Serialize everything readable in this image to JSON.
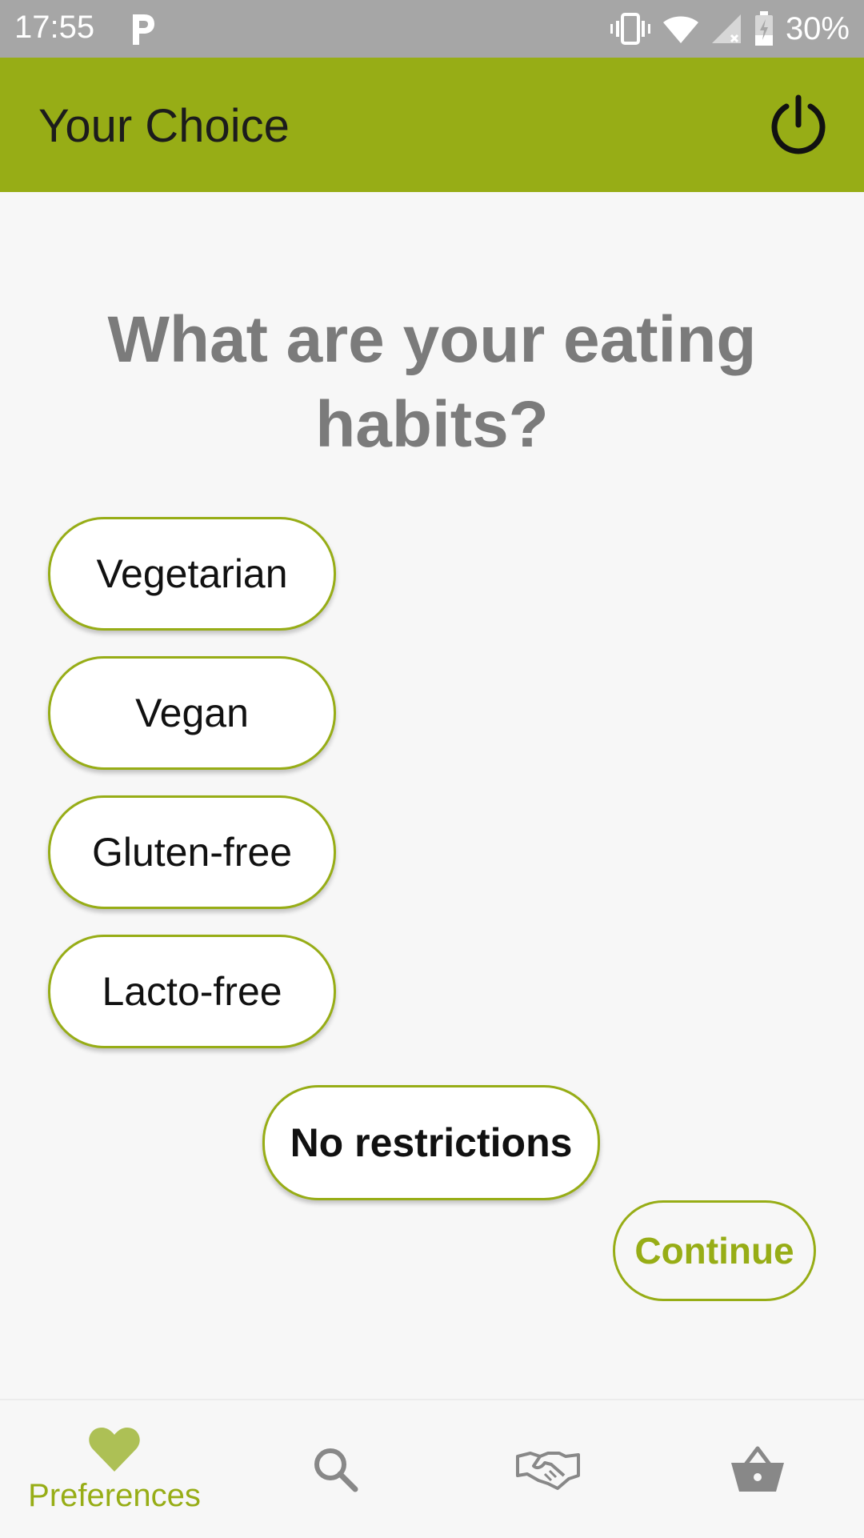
{
  "status_bar": {
    "time": "17:55",
    "battery": "30%"
  },
  "app_bar": {
    "title": "Your Choice",
    "power_icon": "power-icon"
  },
  "question": "What are your eating habits?",
  "options": [
    {
      "label": "Vegetarian"
    },
    {
      "label": "Vegan"
    },
    {
      "label": "Gluten-free"
    },
    {
      "label": "Lacto-free"
    },
    {
      "label": "No restrictions"
    }
  ],
  "continue_label": "Continue",
  "bottom_nav": {
    "items": [
      {
        "label": "Preferences",
        "icon": "heart-icon",
        "active": true
      },
      {
        "label": "",
        "icon": "search-icon",
        "active": false
      },
      {
        "label": "",
        "icon": "handshake-icon",
        "active": false
      },
      {
        "label": "",
        "icon": "basket-icon",
        "active": false
      }
    ]
  },
  "colors": {
    "accent": "#97ad16",
    "question_text": "#7b7b7b",
    "status_bar": "#a6a6a6",
    "inactive_icon": "#888888"
  }
}
